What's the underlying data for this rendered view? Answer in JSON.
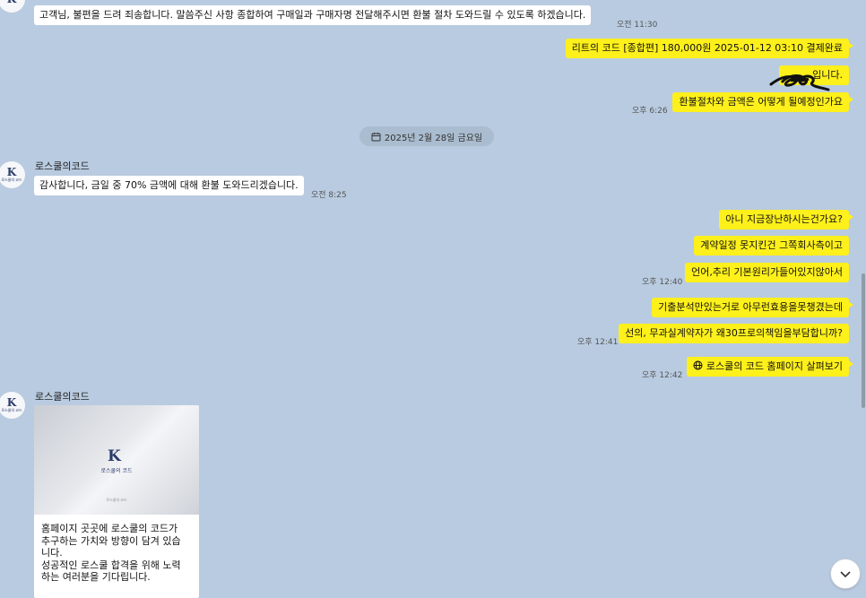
{
  "sender_name": "로스쿨의코드",
  "avatar_logo_text": "로스쿨의 코드",
  "messages": {
    "m1": {
      "text": "고객님, 불편을 드려 죄송합니다. 말씀주신 사항 종합하여 구매일과 구매자명 전달해주시면 환불 절차 도와드릴  수 있도록 하겠습니다.",
      "time": "오전 11:30"
    },
    "m2": {
      "text": "리트의 코드 [종합편]   180,000원   2025-01-12 03:10   결제완료"
    },
    "m3": {
      "text": "입니다."
    },
    "m4": {
      "text": "환불절차와 금액은 어떻게 될예정인가요",
      "time": "오후 6:26"
    },
    "m5": {
      "text": "감사합니다, 금일 중 70% 금액에 대해 환불 도와드리겠습니다.",
      "time": "오전 8:25"
    },
    "m6": {
      "text": "아니 지금장난하시는건가요?"
    },
    "m7": {
      "text": "계약일정 못지킨건 그쪽회사측이고"
    },
    "m8": {
      "text": "언어,추리 기본원리가들어있지않아서",
      "time": "오후 12:40"
    },
    "m9": {
      "text": "기출분석만있는거로 아무런효용을못챙겼는데"
    },
    "m10": {
      "text": "선의, 무과실계약자가 왜30프로의책임을부담합니까?",
      "time": "오후 12:41"
    },
    "m11": {
      "text": "로스쿨의 코드 홈페이지 살펴보기",
      "time": "오후 12:42",
      "icon": "globe-icon"
    }
  },
  "date_divider": "2025년 2월 28일 금요일",
  "card": {
    "logo_name": "로스쿨의 코드",
    "small_text": "로스쿨의 코드",
    "description": "홈페이지 곳곳에 로스쿨의 코드가\n추구하는 가치와 방향이 담겨 있습\n니다.\n성공적인 로스쿨 합격을 위해 노력\n하는 여러분을 기다립니다."
  },
  "colors": {
    "background": "#b9cbe0",
    "outgoing": "#fef01b",
    "incoming": "#ffffff"
  }
}
